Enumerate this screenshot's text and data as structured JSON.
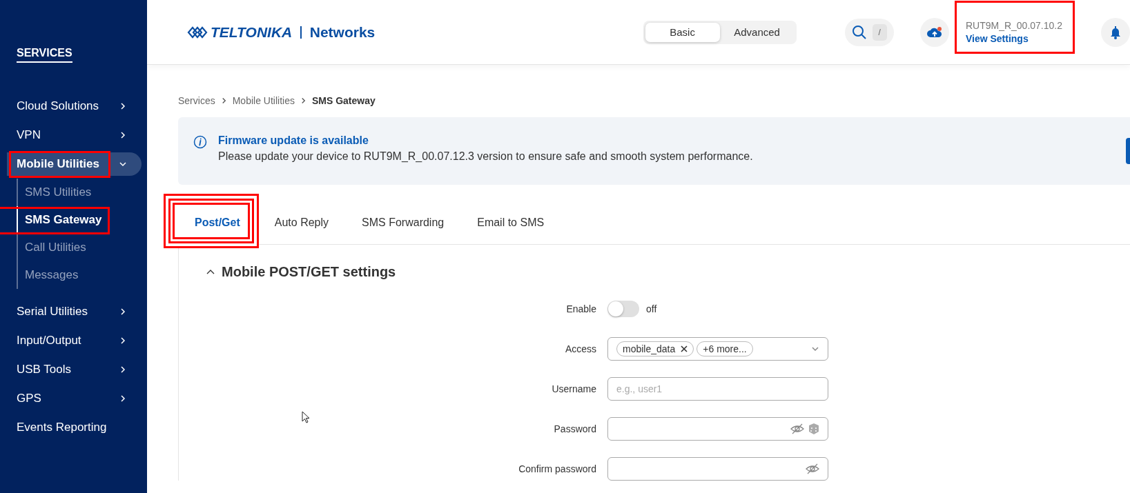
{
  "sidebar": {
    "heading": "SERVICES",
    "items": [
      {
        "label": "Cloud Solutions",
        "expandable": true,
        "expanded": false,
        "highlighted": false
      },
      {
        "label": "VPN",
        "expandable": true,
        "expanded": false,
        "highlighted": false
      },
      {
        "label": "Mobile Utilities",
        "expandable": true,
        "expanded": true,
        "highlighted": true,
        "children": [
          {
            "label": "SMS Utilities",
            "selected": false,
            "highlighted": false
          },
          {
            "label": "SMS Gateway",
            "selected": true,
            "highlighted": true
          },
          {
            "label": "Call Utilities",
            "selected": false,
            "highlighted": false
          },
          {
            "label": "Messages",
            "selected": false,
            "highlighted": false
          }
        ]
      },
      {
        "label": "Serial Utilities",
        "expandable": true,
        "expanded": false,
        "highlighted": false
      },
      {
        "label": "Input/Output",
        "expandable": true,
        "expanded": false,
        "highlighted": false
      },
      {
        "label": "USB Tools",
        "expandable": true,
        "expanded": false,
        "highlighted": false
      },
      {
        "label": "GPS",
        "expandable": true,
        "expanded": false,
        "highlighted": false
      },
      {
        "label": "Events Reporting",
        "expandable": false,
        "expanded": false,
        "highlighted": false
      }
    ]
  },
  "header": {
    "logo": {
      "brand": "TELTONIKA",
      "suffix": "Networks"
    },
    "mode_toggle": [
      {
        "label": "Basic",
        "selected": true
      },
      {
        "label": "Advanced",
        "selected": false
      }
    ],
    "search": {
      "shortcut": "/"
    },
    "cloud": {
      "notification": true
    },
    "device": {
      "firmware": "RUT9M_R_00.07.10.2",
      "link": "View Settings",
      "highlighted": true
    }
  },
  "breadcrumb": [
    {
      "label": "Services",
      "current": false
    },
    {
      "label": "Mobile Utilities",
      "current": false
    },
    {
      "label": "SMS Gateway",
      "current": true
    }
  ],
  "banner": {
    "title": "Firmware update is available",
    "message": "Please update your device to RUT9M_R_00.07.12.3 version to ensure safe and smooth system performance."
  },
  "tabs": [
    {
      "label": "Post/Get",
      "selected": true,
      "highlighted": true
    },
    {
      "label": "Auto Reply",
      "selected": false,
      "highlighted": false
    },
    {
      "label": "SMS Forwarding",
      "selected": false,
      "highlighted": false
    },
    {
      "label": "Email to SMS",
      "selected": false,
      "highlighted": false
    }
  ],
  "section": {
    "title": "Mobile POST/GET settings",
    "expanded": true,
    "fields": [
      {
        "kind": "toggle",
        "label": "Enable",
        "on": false,
        "state_text": "off"
      },
      {
        "kind": "multiselect",
        "label": "Access",
        "chips": [
          {
            "label": "mobile_data",
            "removable": true
          },
          {
            "label": "+6 more...",
            "removable": false
          }
        ]
      },
      {
        "kind": "text",
        "label": "Username",
        "placeholder": "e.g., user1"
      },
      {
        "kind": "password",
        "label": "Password",
        "generator": true
      },
      {
        "kind": "password",
        "label": "Confirm password",
        "generator": false
      }
    ]
  }
}
